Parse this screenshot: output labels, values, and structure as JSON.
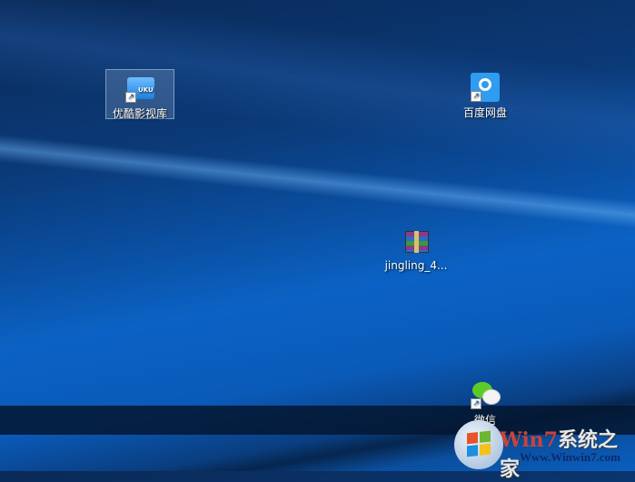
{
  "desktop_icons": [
    {
      "label": "优酷影视库",
      "icon": "youku-folder-icon",
      "selected": true
    },
    {
      "label": "百度网盘",
      "icon": "baidu-netdisk-icon",
      "selected": false
    },
    {
      "label": "jingling_4...",
      "icon": "winrar-archive-icon",
      "selected": false
    },
    {
      "label": "微信",
      "icon": "wechat-icon",
      "selected": false
    }
  ],
  "watermark": {
    "title_prefix": "Win7",
    "title_suffix": "系统之家",
    "url": "Www.Winwin7.com"
  },
  "colors": {
    "desktop": "#0b5ab8",
    "selection": "#7896be"
  }
}
